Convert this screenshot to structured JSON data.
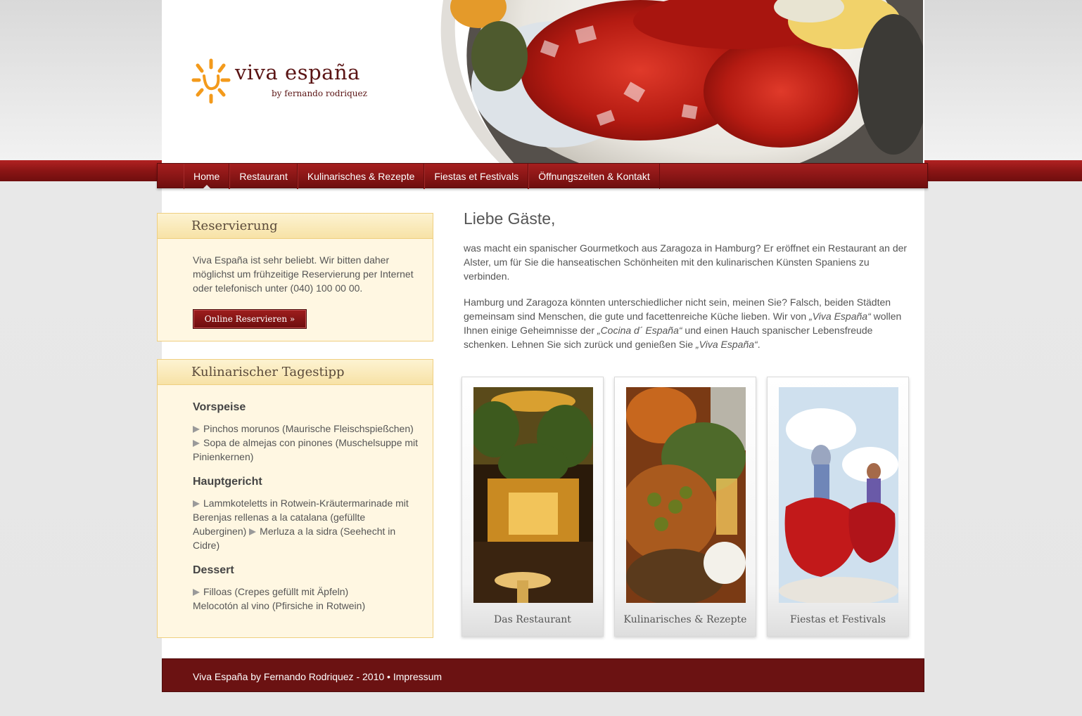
{
  "logo": {
    "title": "viva españa",
    "subtitle": "by fernando rodriquez"
  },
  "nav": {
    "items": [
      {
        "label": "Home",
        "active": true
      },
      {
        "label": "Restaurant",
        "active": false
      },
      {
        "label": "Kulinarisches & Rezepte",
        "active": false
      },
      {
        "label": "Fiestas et Festivals",
        "active": false
      },
      {
        "label": "Öffnungszeiten & Kontakt",
        "active": false
      }
    ]
  },
  "reservation": {
    "title": "Reservierung",
    "text": "Viva España ist sehr beliebt. Wir bitten daher möglichst um frühzeitige Reservierung per Internet oder telefonisch unter (040) 100 00 00.",
    "button": "Online Reservieren »"
  },
  "daily_tip": {
    "title": "Kulinarischer Tagestipp",
    "starter_heading": "Vorspeise",
    "starter_items": [
      "Pinchos morunos (Maurische Fleischspießchen)",
      "Sopa de almejas con pinones (Muschelsuppe mit Pinienkernen)"
    ],
    "main_heading": "Hauptgericht",
    "main_items": [
      "Lammkoteletts in Rotwein-Kräutermarinade mit Berenjas rellenas a la catalana (gefüllte Auberginen)",
      "Merluza a la sidra (Seehecht in Cidre)"
    ],
    "dessert_heading": "Dessert",
    "dessert_items": [
      "Filloas (Crepes gefüllt mit Äpfeln)",
      "Melocotón al vino (Pfirsiche in Rotwein)"
    ]
  },
  "main": {
    "title": "Liebe Gäste,",
    "para1": "was macht ein spanischer Gourmetkoch aus Zaragoza in Hamburg? Er eröffnet ein Restaurant an der Alster, um für Sie die hanseatischen Schönheiten mit den kulinarischen Künsten Spaniens zu verbinden.",
    "para2_a": "Hamburg und Zaragoza könnten unterschiedlicher nicht sein, meinen Sie? Falsch, beiden Städten gemeinsam sind Menschen, die gute und facettenreiche Küche lieben. Wir von ",
    "para2_em1": "„Viva España“",
    "para2_b": " wollen Ihnen einige Geheimnisse der ",
    "para2_em2": "„Cocina d´ España“",
    "para2_c": " und einen Hauch spanischer Lebensfreude schenken. Lehnen Sie sich zurück und genießen Sie ",
    "para2_em3": "„Viva España“",
    "para2_d": "."
  },
  "cards": [
    {
      "label": "Das Restaurant",
      "icon": "restaurant-photo"
    },
    {
      "label": "Kulinarisches & Rezepte",
      "icon": "tapas-photo"
    },
    {
      "label": "Fiestas et Festivals",
      "icon": "flamenco-dancers-photo"
    }
  ],
  "footer": {
    "text": "Viva España by Fernando Rodriquez - 2010",
    "separator": "•",
    "link": "Impressum"
  },
  "colors": {
    "brand_red": "#8b1515",
    "box_bg": "#fff7e2",
    "box_border": "#efcf80",
    "sun_orange": "#f39a1b"
  }
}
